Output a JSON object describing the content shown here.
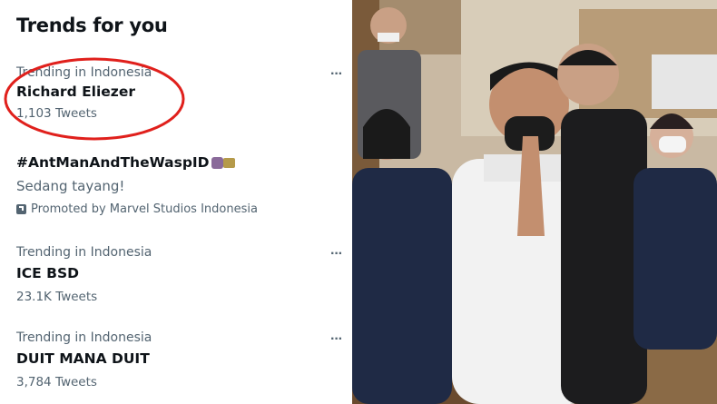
{
  "panel": {
    "title": "Trends for you",
    "trends": [
      {
        "context": "Trending in Indonesia",
        "name": "Richard Eliezer",
        "count": "1,103 Tweets"
      },
      {
        "name": "#AntManAndTheWaspID",
        "subtitle": "Sedang tayang!",
        "promoted": "Promoted by Marvel Studios Indonesia"
      },
      {
        "context": "Trending in Indonesia",
        "name": "ICE BSD",
        "count": "23.1K Tweets"
      },
      {
        "context": "Trending in Indonesia",
        "name": "DUIT MANA DUIT",
        "count": "3,784 Tweets"
      }
    ],
    "more_glyph": "···"
  },
  "colors": {
    "text_primary": "#0f1419",
    "text_secondary": "#536471",
    "highlight_circle": "#e0201c"
  },
  "icons": [
    "more-options-icon",
    "promoted-icon",
    "antman-emoji-icon",
    "wasp-emoji-icon"
  ]
}
